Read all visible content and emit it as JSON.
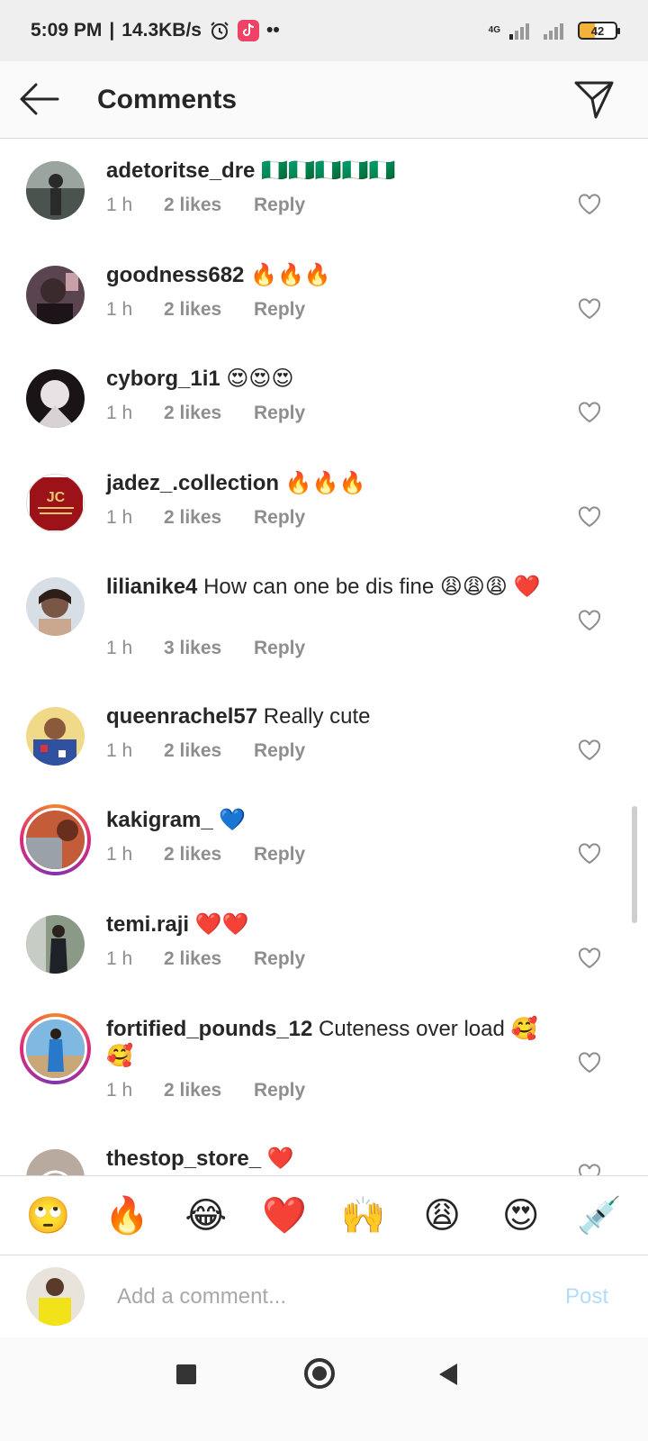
{
  "status_bar": {
    "time": "5:09 PM",
    "speed": "14.3KB/s",
    "network": "4G",
    "battery": "42"
  },
  "header": {
    "title": "Comments"
  },
  "comments": [
    {
      "user": "adetoritse_dre",
      "text": "🇳🇬🇳🇬🇳🇬🇳🇬🇳🇬",
      "time": "1 h",
      "likes": "2 likes",
      "reply": "Reply",
      "avatar_color": "#6b7a72"
    },
    {
      "user": "goodness682",
      "text": "🔥🔥🔥",
      "time": "1 h",
      "likes": "2 likes",
      "reply": "Reply",
      "avatar_color": "#3a2a2e"
    },
    {
      "user": "cyborg_1i1",
      "text": "😍😍😍",
      "time": "1 h",
      "likes": "2 likes",
      "reply": "Reply",
      "avatar_color": "#c9c2c4"
    },
    {
      "user": "jadez_.collection",
      "text": "🔥🔥🔥",
      "time": "1 h",
      "likes": "2 likes",
      "reply": "Reply",
      "avatar_color": "#9d1218"
    },
    {
      "user": "lilianike4",
      "text": "How can one be dis fine 😩😩😩 ❤️",
      "time": "1 h",
      "likes": "3 likes",
      "reply": "Reply",
      "avatar_color": "#8a6a5a"
    },
    {
      "user": "queenrachel57",
      "text": "Really cute",
      "time": "1 h",
      "likes": "2 likes",
      "reply": "Reply",
      "avatar_color": "#e9c97a"
    },
    {
      "user": "kakigram_",
      "text": "💙",
      "time": "1 h",
      "likes": "2 likes",
      "reply": "Reply",
      "avatar_color": "#b55a3c"
    },
    {
      "user": "temi.raji",
      "text": "❤️❤️",
      "time": "1 h",
      "likes": "2 likes",
      "reply": "Reply",
      "avatar_color": "#5f6b5b"
    },
    {
      "user": "fortified_pounds_12",
      "text": "Cuteness over load 🥰 🥰",
      "time": "1 h",
      "likes": "2 likes",
      "reply": "Reply",
      "avatar_color": "#4a8fc4"
    },
    {
      "user": "thestop_store_",
      "text": "❤️",
      "time": "",
      "likes": "",
      "reply": "",
      "avatar_color": "#b9aaa0"
    }
  ],
  "emoji_bar": [
    "🙄",
    "🔥",
    "😂",
    "❤️",
    "🙌",
    "😩",
    "😍",
    "💉"
  ],
  "input": {
    "placeholder": "Add a comment...",
    "post_label": "Post"
  },
  "colors": {
    "accent_disabled": "#b3dbff",
    "text_primary": "#262626",
    "text_secondary": "#8e8e8e"
  }
}
